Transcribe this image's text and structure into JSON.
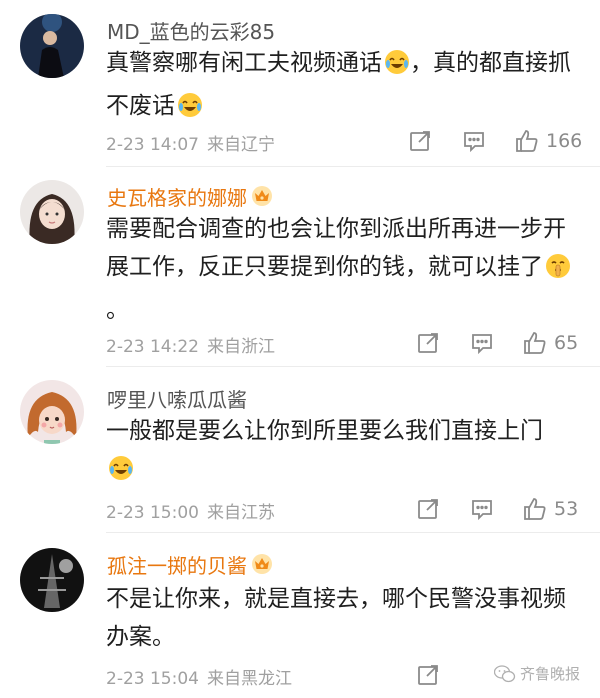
{
  "comments": [
    {
      "username": "MD_蓝色的云彩85",
      "vip": false,
      "text": "真警察哪有闲工夫视频通话",
      "text_after": "，真的都直接抓不废话",
      "date": "2-23 14:07",
      "location": "来自辽宁",
      "likes": "166"
    },
    {
      "username": "史瓦格家的娜娜",
      "vip": true,
      "text": "需要配合调查的也会让你到派出所再进一步开展工作，反正只要提到你的钱，就可以挂了",
      "text_after": "。",
      "date": "2-23 14:22",
      "location": "来自浙江",
      "likes": "65"
    },
    {
      "username": "啰里八嗦瓜瓜酱",
      "vip": false,
      "text": "一般都是要么让你到所里要么我们直接上门",
      "text_after": "",
      "date": "2-23 15:00",
      "location": "来自江苏",
      "likes": "53"
    },
    {
      "username": "孤注一掷的贝酱",
      "vip": true,
      "text": "不是让你来，就是直接去，哪个民警没事视频办案。",
      "text_after": "",
      "date": "2-23 15:04",
      "location": "来自黑龙江",
      "likes": ""
    }
  ],
  "watermark": "齐鲁晚报",
  "icons": {
    "forward": "forward-icon",
    "comment": "comment-icon",
    "like": "thumbs-up-icon",
    "emoji_laugh": "laughing-crying-emoji-icon",
    "emoji_shush": "shushing-face-emoji-icon",
    "vip_crown": "crown-badge-icon"
  },
  "colors": {
    "vip_name": "#e8770f",
    "name": "#555555",
    "meta": "#a0a0a0"
  }
}
